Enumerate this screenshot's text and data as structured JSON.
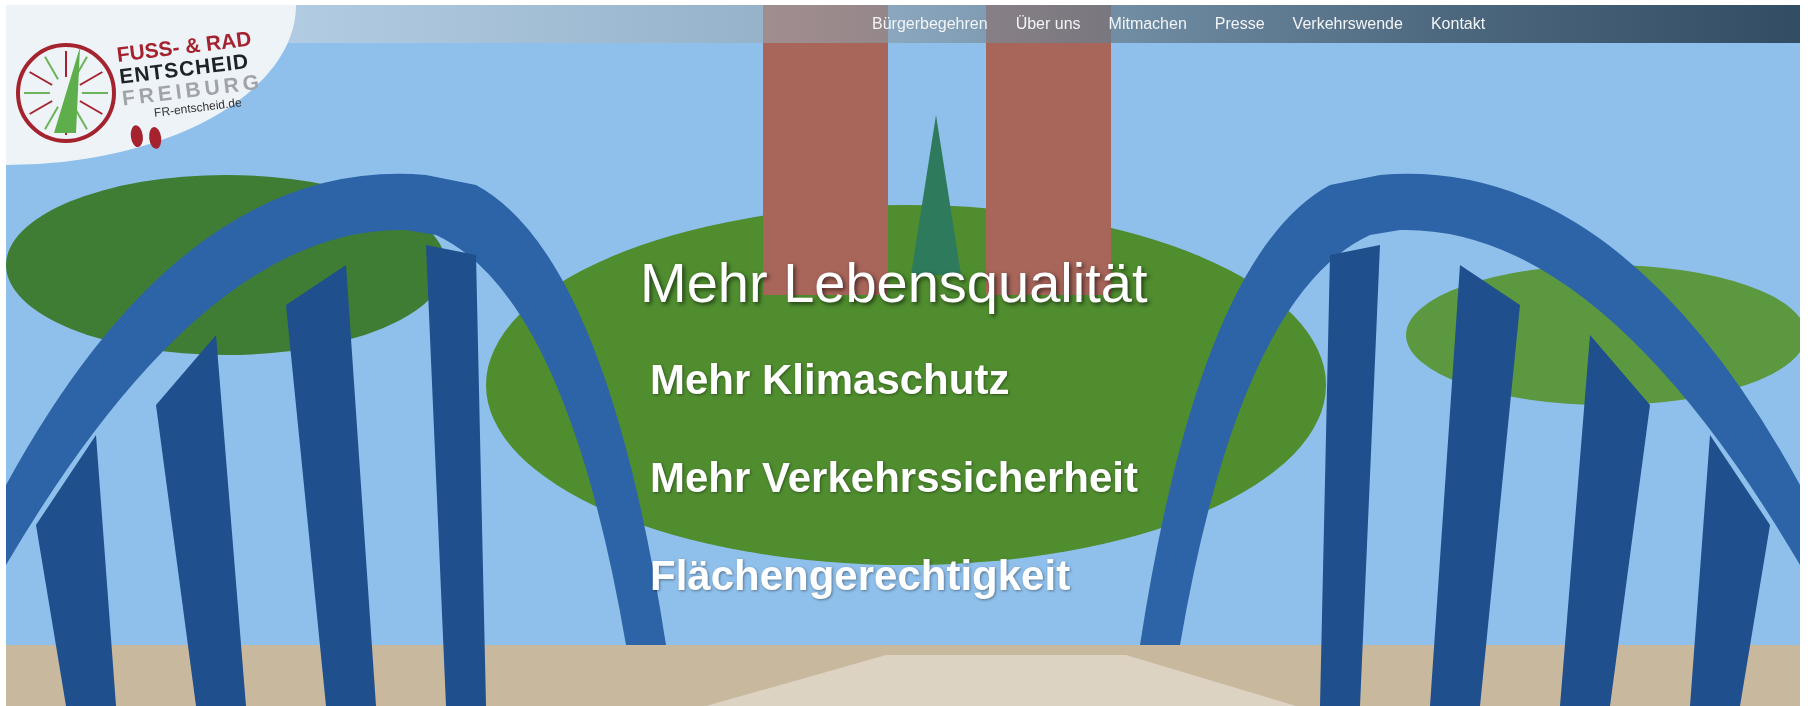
{
  "logo": {
    "line_1": "FUSS- & RAD",
    "line_2": "ENTSCHEID",
    "line_3": "FREIBURG",
    "url": "FR-entscheid.de"
  },
  "nav": [
    {
      "label": "Bürgerbegehren"
    },
    {
      "label": "Über uns"
    },
    {
      "label": "Mitmachen"
    },
    {
      "label": "Presse"
    },
    {
      "label": "Verkehrswende"
    },
    {
      "label": "Kontakt"
    }
  ],
  "hero": {
    "kind": "picture",
    "headline": "Mehr Lebensqualität",
    "goals": [
      "Mehr Klimaschutz",
      "Mehr Verkehrssicherheit",
      "Flächengerechtigkeit"
    ]
  }
}
